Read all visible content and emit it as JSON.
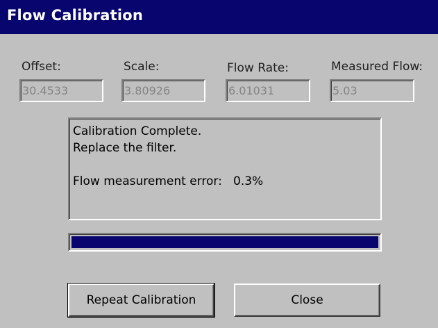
{
  "window": {
    "title": "Flow Calibration"
  },
  "fields": {
    "offset": {
      "label": "Offset:",
      "value": "30.4533"
    },
    "scale": {
      "label": "Scale:",
      "value": "3.80926"
    },
    "flow_rate": {
      "label": "Flow Rate:",
      "value": "6.01031"
    },
    "measured_flow": {
      "label": "Measured Flow:",
      "value": "5.03"
    }
  },
  "message": {
    "line1": "Calibration Complete.",
    "line2": "Replace the filter.",
    "line3": "",
    "line4": "Flow measurement error:   0.3%"
  },
  "progress": {
    "fraction": 1.0
  },
  "buttons": {
    "repeat_label": "Repeat Calibration",
    "close_label": "Close"
  },
  "colors": {
    "titlebar": "#08056e",
    "face": "#c0c0c0",
    "progress_fill": "#08056e",
    "disabled_text": "#848484"
  }
}
